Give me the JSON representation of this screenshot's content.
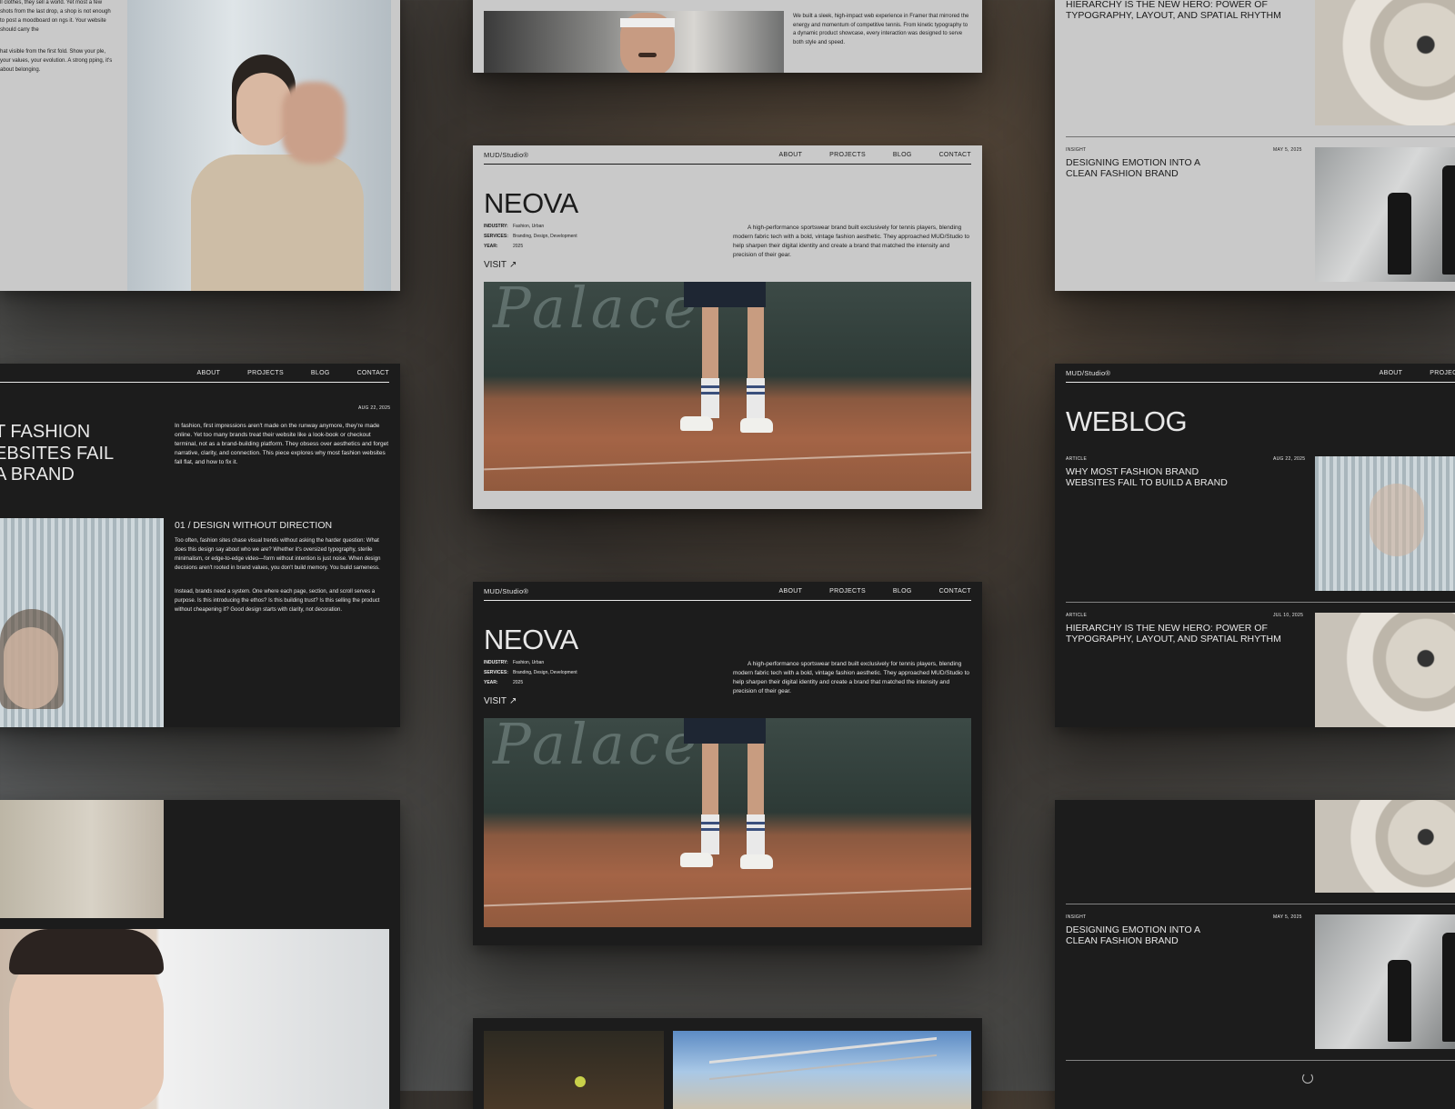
{
  "brand": {
    "logo": "MUD/Studio®"
  },
  "nav_links": {
    "about": "ABOUT",
    "projects": "PROJECTS",
    "blog": "BLOG",
    "contact": "CONTACT"
  },
  "case_study": {
    "title": "NEOVA",
    "industry_label": "INDUSTRY:",
    "industry": "Fashion, Urban",
    "services_label": "SERVICES:",
    "services": "Branding, Design, Development",
    "year_label": "YEAR:",
    "year": "2025",
    "visit": "VISIT",
    "description": "A high-performance sportswear brand built exclusively for tennis players, blending modern fabric tech with a bold, vintage fashion aesthetic. They approached MUD/Studio to help sharpen their digital identity and create a brand that matched the intensity and precision of their gear.",
    "photo_script": "Palace"
  },
  "top_card": {
    "text": "We built a sleek, high-impact web experience in Framer that mirrored the energy and momentum of competitive tennis. From kinetic typography to a dynamic product showcase, every interaction was designed to serve both style and speed."
  },
  "top_left_card": {
    "text1": "ll clothes, they sell a world. Yet most a few shots from the last drop, a shop is not enough to post a moodboard on ngs it. Your website should carry the",
    "text2": "hat visible from the first fold. Show your ple, your values, your evolution. A strong pping, it's about belonging."
  },
  "article": {
    "date": "AUG 22, 2025",
    "title_lines": [
      "T FASHION",
      "EBSITES FAIL",
      "A BRAND"
    ],
    "intro": "In fashion, first impressions aren't made on the runway anymore, they're made online. Yet too many brands treat their website like a look-book or checkout terminal, not as a brand-building platform. They obsess over aesthetics and forget narrative, clarity, and connection. This piece explores why most fashion websites fall flat, and how to fix it.",
    "section_heading": "01 / DESIGN WITHOUT DIRECTION",
    "section_p1": "Too often, fashion sites chase visual trends without asking the harder question: What does this design say about who we are? Whether it's oversized typography, sterile minimalism, or edge-to-edge video—form without intention is just noise. When design decisions aren't rooted in brand values, you don't build memory. You build sameness.",
    "section_p2": "Instead, brands need a system. One where each page, section, and scroll serves a purpose. Is this introducing the ethos? Is this building trust? Is this selling the product without cheapening it? Good design starts with clarity, not decoration."
  },
  "weblog": {
    "title": "WEBLOG",
    "articles": [
      {
        "tag": "ARTICLE",
        "date": "AUG 22, 2025",
        "title": "WHY MOST FASHION BRAND WEBSITES FAIL TO BUILD A BRAND"
      },
      {
        "tag": "ARTICLE",
        "date": "JUL 10, 2025",
        "title": "HIERARCHY IS THE NEW HERO: POWER OF TYPOGRAPHY, LAYOUT, AND SPATIAL RHYTHM"
      },
      {
        "tag": "INSIGHT",
        "date": "MAY 5, 2025",
        "title": "DESIGNING EMOTION INTO A CLEAN FASHION BRAND"
      }
    ]
  },
  "colors": {
    "light_card": "#c9c9c9",
    "dark_card": "#1c1c1c"
  }
}
